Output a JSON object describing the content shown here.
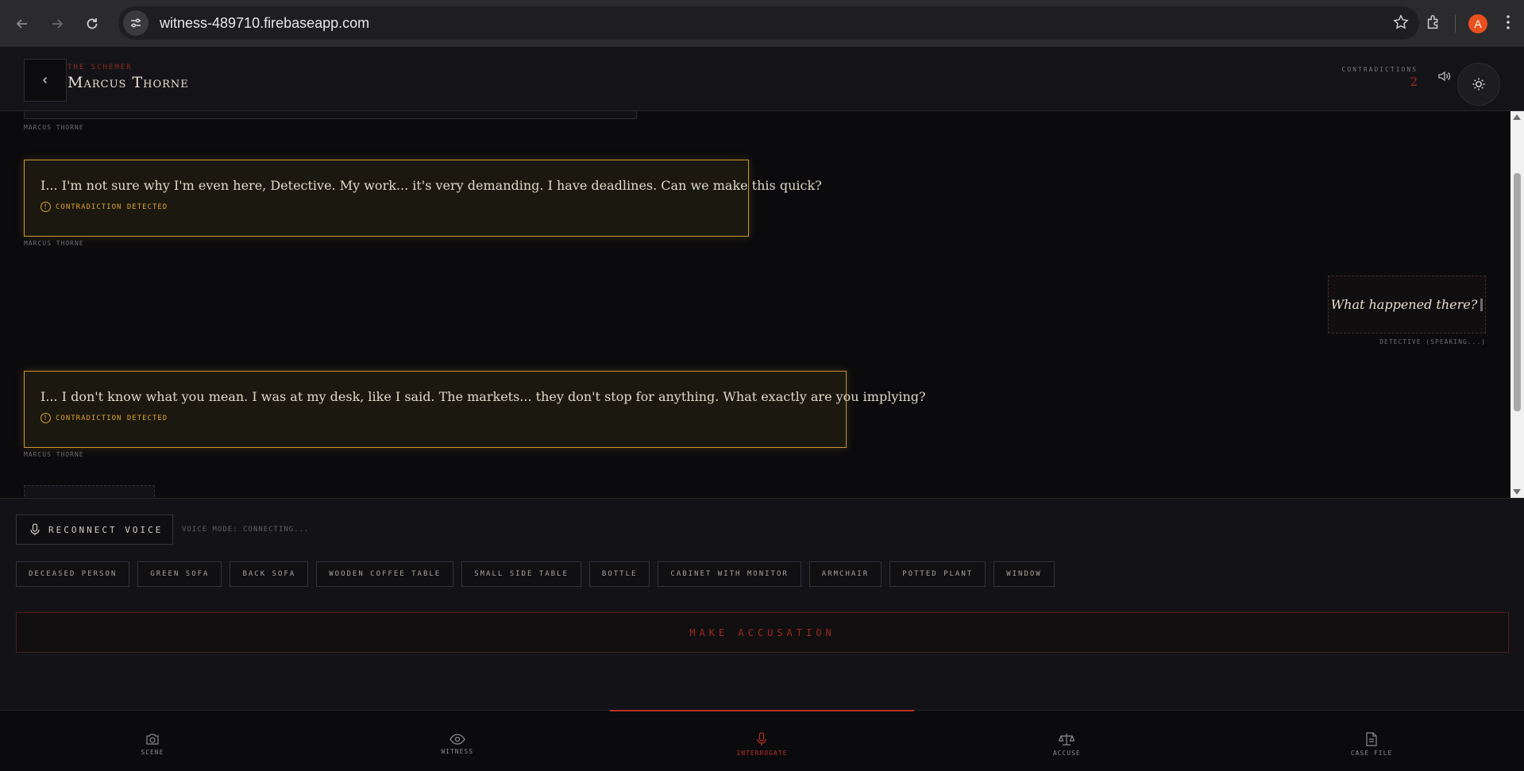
{
  "browser": {
    "url": "witness-489710.firebaseapp.com",
    "profile_initial": "A"
  },
  "header": {
    "role": "THE SCHEMER",
    "name": "Marcus Thorne",
    "contradictions_label": "CONTRADICTIONS",
    "contradictions_count": "2"
  },
  "transcript": {
    "messages": [
      {
        "speaker": "MARCUS THORNE"
      },
      {
        "text": "I... I'm not sure why I'm even here, Detective. My work... it's very demanding. I have deadlines. Can we make this quick?",
        "flag": "CONTRADICTION DETECTED",
        "speaker": "MARCUS THORNE"
      },
      {
        "text": "What happened there?",
        "speaker": "DETECTIVE (SPEAKING...)"
      },
      {
        "text": "I... I don't know what you mean. I was at my desk, like I said. The markets... they don't stop for anything. What exactly are you implying?",
        "flag": "CONTRADICTION DETECTED",
        "speaker": "MARCUS THORNE"
      }
    ]
  },
  "controls": {
    "reconnect_label": "RECONNECT VOICE",
    "voice_status": "VOICE MODE: CONNECTING...",
    "chips": [
      "DECEASED PERSON",
      "GREEN SOFA",
      "BACK SOFA",
      "WOODEN COFFEE TABLE",
      "SMALL SIDE TABLE",
      "BOTTLE",
      "CABINET WITH MONITOR",
      "ARMCHAIR",
      "POTTED PLANT",
      "WINDOW"
    ],
    "accuse_label": "MAKE ACCUSATION"
  },
  "nav": {
    "tabs": [
      {
        "label": "SCENE",
        "icon": "camera-icon"
      },
      {
        "label": "WITNESS",
        "icon": "eye-icon"
      },
      {
        "label": "INTERROGATE",
        "icon": "microphone-icon",
        "active": true
      },
      {
        "label": "ACCUSE",
        "icon": "scales-icon"
      },
      {
        "label": "CASE FILE",
        "icon": "document-icon"
      }
    ]
  },
  "colors": {
    "accent_red": "#b93028",
    "contradiction_gold": "#c89530",
    "background": "#0b0b0d"
  }
}
